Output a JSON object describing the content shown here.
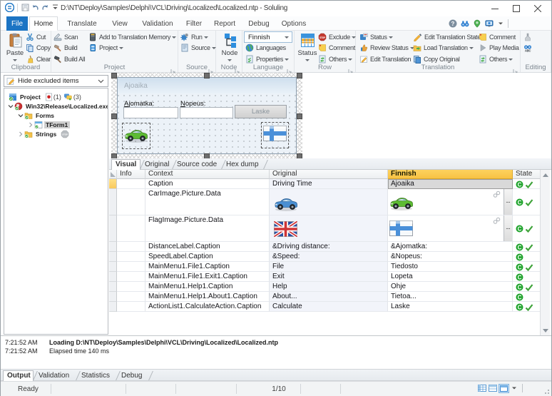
{
  "window": {
    "title": "D:\\NT\\Deploy\\Samples\\Delphi\\VCL\\Driving\\Localized\\Localized.ntp  -  Soluling",
    "controls": [
      "minimize",
      "maximize",
      "close"
    ],
    "quick_access": [
      {
        "icon": "app-logo-icon"
      },
      {
        "icon": "save-icon"
      },
      {
        "icon": "undo-icon"
      },
      {
        "icon": "redo-icon"
      },
      {
        "icon": "qat-dropdown-icon"
      }
    ]
  },
  "menu_tabs": {
    "items": [
      "File",
      "Home",
      "Translate",
      "View",
      "Validation",
      "Filter",
      "Report",
      "Debug",
      "Options"
    ],
    "active": "Home",
    "right_icons": [
      "help-icon",
      "binoculars-icon",
      "location-pin-icon",
      "monitor-icon",
      "chevron-down-icon"
    ]
  },
  "ribbon": {
    "groups": [
      {
        "label": "Clipboard",
        "launcher": false,
        "big": [
          {
            "label": "Paste",
            "icon": "paste-icon",
            "arrow": true
          }
        ],
        "cols": [
          [
            {
              "label": "Cut",
              "icon": "cut-icon"
            },
            {
              "label": "Copy",
              "icon": "copy-icon"
            },
            {
              "label": "Clear",
              "icon": "clear-icon"
            }
          ]
        ]
      },
      {
        "label": "Project",
        "launcher": true,
        "big": [],
        "cols": [
          [
            {
              "label": "Scan",
              "icon": "scan-icon"
            },
            {
              "label": "Build",
              "icon": "build-icon"
            },
            {
              "label": "Build All",
              "icon": "build-all-icon"
            }
          ],
          [
            {
              "label": "Add to Translation Memory",
              "icon": "translation-memory-icon",
              "arrow": true
            },
            {
              "label": "Project",
              "icon": "project-icon",
              "arrow": true
            }
          ]
        ]
      },
      {
        "label": "Source",
        "launcher": true,
        "big": [],
        "cols": [
          [
            {
              "label": "Run",
              "icon": "run-icon",
              "arrow": true
            },
            {
              "label": "Source",
              "icon": "source-icon",
              "arrow": true
            }
          ]
        ]
      },
      {
        "label": "Node",
        "launcher": true,
        "big": [
          {
            "label": "Node",
            "icon": "node-icon",
            "arrow": true
          }
        ],
        "cols": []
      },
      {
        "label": "Language",
        "launcher": true,
        "big": [],
        "combo": {
          "value": "Finnish"
        },
        "cols": [
          [
            {
              "label": "Languages",
              "icon": "globe-icon"
            },
            {
              "label": "Properties",
              "icon": "properties-icon",
              "arrow": true
            }
          ]
        ]
      },
      {
        "label": "Row",
        "launcher": true,
        "big": [
          {
            "label": "Status",
            "icon": "row-status-icon",
            "arrow": true
          }
        ],
        "cols": [
          [
            {
              "label": "Exclude",
              "icon": "exclude-icon",
              "arrow": true
            },
            {
              "label": "Comment",
              "icon": "comment-note-icon"
            },
            {
              "label": "Others",
              "icon": "others-icon",
              "arrow": true
            }
          ]
        ]
      },
      {
        "label": "Translation",
        "launcher": true,
        "big": [],
        "cols": [
          [
            {
              "label": "Status",
              "icon": "translation-status-icon",
              "arrow": true
            },
            {
              "label": "Review Status",
              "icon": "review-status-icon",
              "arrow": true
            },
            {
              "label": "Edit Translation",
              "icon": "edit-translation-icon"
            }
          ],
          [
            {
              "label": "Edit Translation State",
              "icon": "edit-state-icon"
            },
            {
              "label": "Load Translation",
              "icon": "load-translation-icon",
              "arrow": true
            },
            {
              "label": "Copy Original",
              "icon": "copy-original-icon"
            }
          ],
          [
            {
              "label": "Comment",
              "icon": "comment-note-icon"
            },
            {
              "label": "Play Media",
              "icon": "play-media-icon"
            },
            {
              "label": "Others",
              "icon": "others-icon",
              "arrow": true
            }
          ]
        ]
      },
      {
        "label": "Editing",
        "launcher": false,
        "big": [],
        "cols": [
          [
            {
              "label": "",
              "icon": "fill-icon"
            },
            {
              "label": "",
              "icon": "spell-check-icon"
            }
          ]
        ]
      }
    ]
  },
  "left_panel": {
    "filter": {
      "value": "Hide excluded items",
      "icon": "edit-pencil-icon"
    },
    "tree": [
      {
        "label": "Project",
        "icon": "project-node-icon",
        "level": 0,
        "chevron": "none",
        "badges": [
          {
            "icon": "red-dot-doc-icon",
            "text": "(1)"
          },
          {
            "icon": "bubbles-icon",
            "text": "(3)"
          }
        ]
      },
      {
        "label": "Win32\\Release\\Localized.exe",
        "icon": "delphi-exe-icon",
        "level": 1,
        "chevron": "down"
      },
      {
        "label": "Forms",
        "icon": "folder-check-icon",
        "level": 2,
        "chevron": "down"
      },
      {
        "label": "TForm1",
        "icon": "form-icon",
        "level": 3,
        "chevron": "right",
        "selected": true
      },
      {
        "label": "Strings",
        "icon": "folder-check-icon",
        "level": 2,
        "chevron": "right",
        "badges": [
          {
            "icon": "stop-badge-icon",
            "text": ""
          }
        ]
      }
    ]
  },
  "form_preview": {
    "caption": "Ajoaika",
    "labels": [
      {
        "text": "Ajomatka:",
        "accel": "A"
      },
      {
        "text": "Nopeus:",
        "accel": "N"
      }
    ],
    "button": "Laske",
    "images": [
      "car-green",
      "flag-finland"
    ]
  },
  "view_tabs": {
    "items": [
      "Visual",
      "Original",
      "Source code",
      "Hex dump"
    ],
    "active": "Visual"
  },
  "grid": {
    "columns": [
      "",
      "Info",
      "Context",
      "Original",
      "Finnish",
      "State"
    ],
    "highlight_column": "Finnish",
    "rows": [
      {
        "context": "Caption",
        "original": "Driving Time",
        "finnish": "Ajoaika",
        "translated": true,
        "checked": true,
        "current": true,
        "focus": true
      },
      {
        "context": "CarImage.Picture.Data",
        "original_img": "car-blue",
        "finnish_img": "car-green",
        "translated": true,
        "checked": true,
        "image_row": true
      },
      {
        "context": "FlagImage.Picture.Data",
        "original_img": "flag-uk",
        "finnish_img": "flag-finland",
        "translated": true,
        "checked": true,
        "image_row": true
      },
      {
        "context": "DistanceLabel.Caption",
        "original": "&Driving distance:",
        "finnish": "&Ajomatka:",
        "translated": true,
        "checked": true
      },
      {
        "context": "SpeedLabel.Caption",
        "original": "&Speed:",
        "finnish": "&Nopeus:",
        "translated": true,
        "checked": false
      },
      {
        "context": "MainMenu1.File1.Caption",
        "original": "File",
        "finnish": "Tiedosto",
        "translated": true,
        "checked": true
      },
      {
        "context": "MainMenu1.File1.Exit1.Caption",
        "original": "Exit",
        "finnish": "Lopeta",
        "translated": true,
        "checked": false
      },
      {
        "context": "MainMenu1.Help1.Caption",
        "original": "Help",
        "finnish": "Ohje",
        "translated": true,
        "checked": true
      },
      {
        "context": "MainMenu1.Help1.About1.Caption",
        "original": "About...",
        "finnish": "Tietoa...",
        "translated": true,
        "checked": false
      },
      {
        "context": "ActionList1.CalculateAction.Caption",
        "original": "Calculate",
        "finnish": "Laske",
        "translated": true,
        "checked": true
      }
    ]
  },
  "output": {
    "lines": [
      {
        "time": "7:21:52 AM",
        "message": "Loading D:\\NT\\Deploy\\Samples\\Delphi\\VCL\\Driving\\Localized\\Localized.ntp",
        "bold": true
      },
      {
        "time": "7:21:52 AM",
        "message": "Elapsed time 140 ms",
        "bold": false
      }
    ]
  },
  "bottom_tabs": {
    "items": [
      "Output",
      "Validation",
      "Statistics",
      "Debug"
    ],
    "active": "Output"
  },
  "status_bar": {
    "ready": "Ready",
    "position": "1/10",
    "icons": [
      "grid-view-icon",
      "split-view-icon",
      "form-view-icon",
      "chevron-down-icon"
    ]
  },
  "colors": {
    "accent_blue": "#1b74c4",
    "finnish_header_gold": "#f8c243",
    "state_green": "#1ea32b",
    "current_row_amber": "#f9c95c"
  }
}
